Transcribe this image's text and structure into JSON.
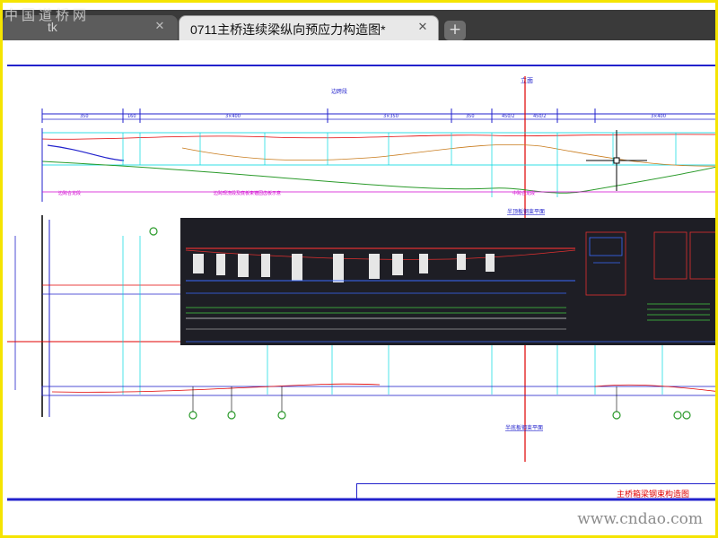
{
  "watermark_top": "中国道桥网",
  "watermark_bottom": "www.cndao.com",
  "tabs": [
    {
      "label": "tk",
      "close": "✕",
      "active": false
    },
    {
      "label": "0711主桥连续梁纵向预应力构造图*",
      "close": "✕",
      "active": true
    }
  ],
  "new_tab": "+",
  "drawing": {
    "sheet_title": "主桥箱梁钢束构造图",
    "center_label": "立面",
    "section_label_left": "边跨段",
    "plan_label_top": "半顶板钢束平面",
    "plan_label_bottom": "半底板钢束平面",
    "note_left": "边跨合龙段",
    "note_mid": "边跨现浇段及底板束锚固齿板示意",
    "note_right": "中跨合龙段",
    "dims_top": [
      "350",
      "160",
      "3×400",
      "3×350",
      "350",
      "450/2",
      "450/2",
      "3×400"
    ]
  },
  "colors": {
    "tab_bar": "#3a3a3a",
    "active_tab": "#e8e8e8",
    "frame_border": "#f5e400",
    "cad_blue": "#2222cc",
    "cad_cyan": "#00d8e0",
    "cad_red": "#e00000",
    "cad_green": "#2a9a2a",
    "inset_bg": "#1e1e25"
  }
}
